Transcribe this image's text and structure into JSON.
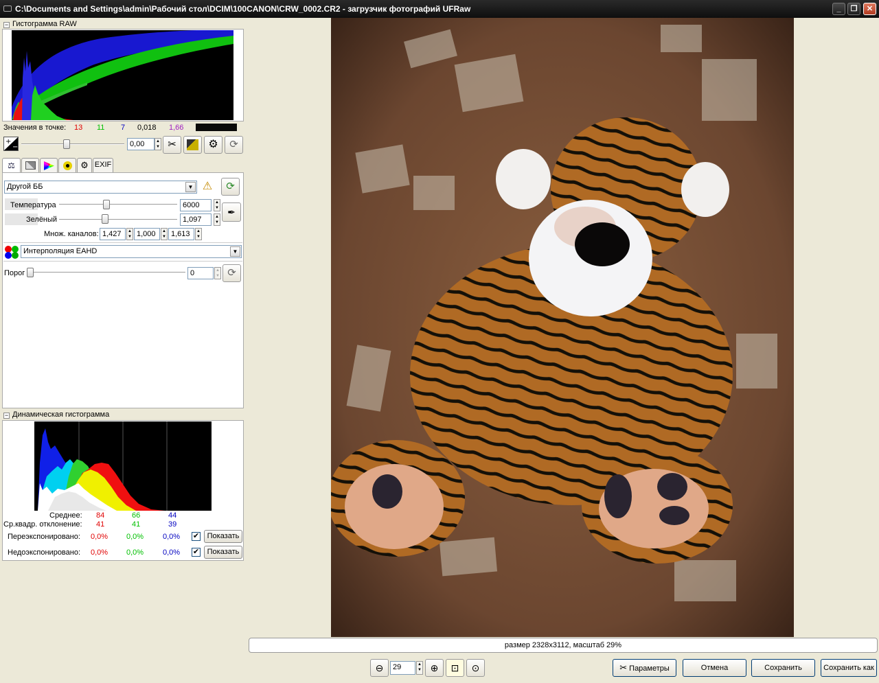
{
  "window": {
    "title": "C:\\Documents and Settings\\admin\\Рабочий стол\\DCIM\\100CANON\\CRW_0002.CR2 - загрузчик фотографий UFRaw",
    "minimize": "_",
    "maximize": "❐",
    "close": "✕"
  },
  "raw_histogram": {
    "title": "Гистограмма RAW",
    "toggle": "−"
  },
  "point_values": {
    "label": "Значения в точке:",
    "r": "13",
    "g": "11",
    "b": "7",
    "lum": "0,018",
    "ev": "1,66",
    "swatch_color": "#0a0a0a"
  },
  "exposure": {
    "value": "0,00",
    "value_fraction": 0.44
  },
  "tabs": [
    {
      "name": "white-balance",
      "label": ""
    },
    {
      "name": "grayscale",
      "label": ""
    },
    {
      "name": "color-management",
      "label": ""
    },
    {
      "name": "curves",
      "label": ""
    },
    {
      "name": "crop",
      "label": ""
    },
    {
      "name": "exif",
      "label": "EXIF"
    }
  ],
  "white_balance": {
    "preset": "Другой ББ",
    "temperature_label": "Температура",
    "temperature_value": "6000",
    "green_label": "Зелёный",
    "green_value": "1,097",
    "multipliers_label": "Множ. каналов:",
    "multipliers": [
      "1,427",
      "1,000",
      "1,613"
    ]
  },
  "interpolation": {
    "value": "Интерполяция EAHD"
  },
  "threshold": {
    "label": "Порог",
    "value": "0"
  },
  "live_histogram": {
    "title": "Динамическая гистограмма",
    "toggle": "−",
    "mean_label": "Среднее:",
    "mean": [
      "84",
      "66",
      "44"
    ],
    "std_label": "Ср.квадр. отклонение:",
    "std": [
      "41",
      "41",
      "39"
    ],
    "over_label": "Переэкспонировано:",
    "over": [
      "0,0%",
      "0,0%",
      "0,0%"
    ],
    "under_label": "Недоэкспонировано:",
    "under": [
      "0,0%",
      "0,0%",
      "0,0%"
    ],
    "show_label": "Показать",
    "checkmark": "✔"
  },
  "status": {
    "text": "размер 2328x3112, масштаб 29%"
  },
  "zoom": {
    "value": "29"
  },
  "actions": {
    "options": "Параметры",
    "cancel": "Отмена",
    "save": "Сохранить",
    "save_as": "Сохранить как"
  },
  "colors": {
    "accent_red": "#e00000",
    "accent_green": "#00c000",
    "accent_blue": "#0000c0"
  }
}
